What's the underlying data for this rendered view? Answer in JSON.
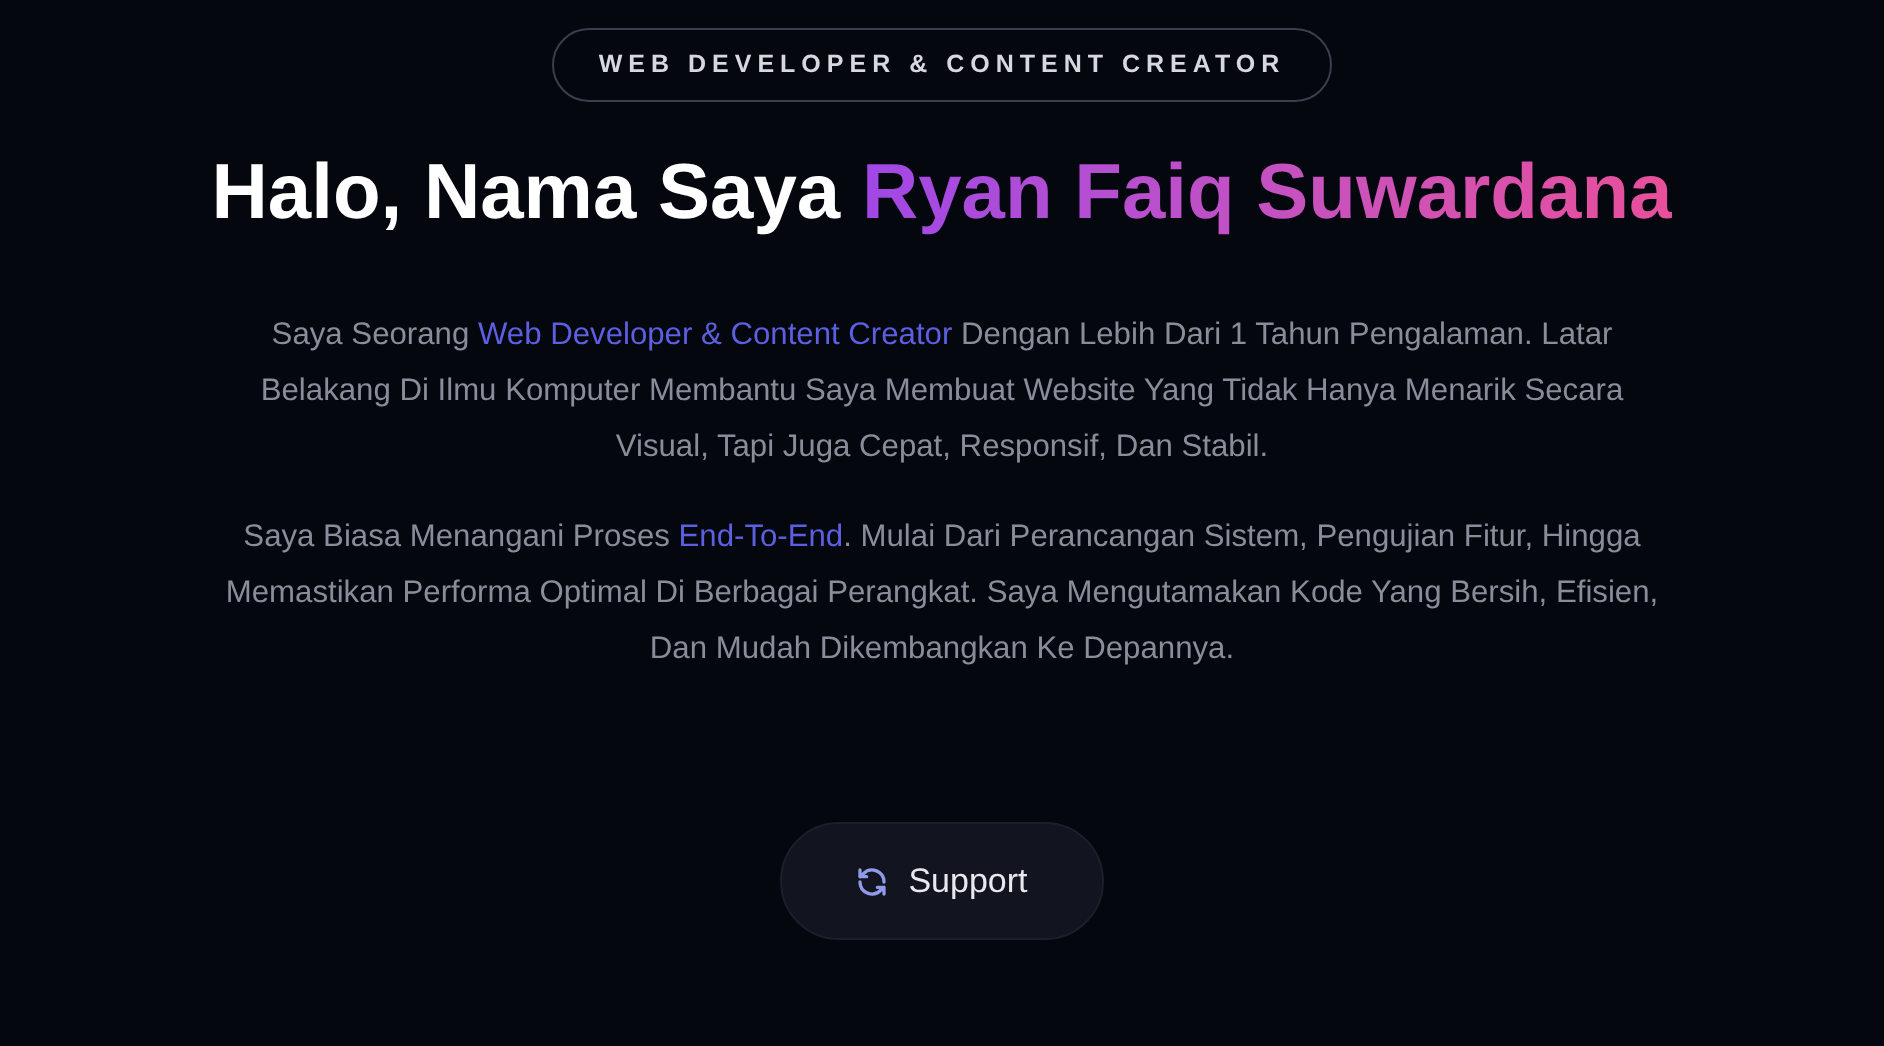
{
  "badge": "WEB DEVELOPER & CONTENT CREATOR",
  "heading": {
    "lead": "Halo, Nama Saya ",
    "name": "Ryan Faiq Suwardana"
  },
  "paragraphs": [
    [
      {
        "text": "Saya Seorang ",
        "highlight": false
      },
      {
        "text": "Web Developer & Content Creator",
        "highlight": true
      },
      {
        "text": " Dengan Lebih Dari 1 Tahun Pengalaman. Latar Belakang Di Ilmu Komputer Membantu Saya Membuat Website Yang Tidak Hanya Menarik Secara Visual, Tapi Juga Cepat, Responsif, Dan Stabil.",
        "highlight": false
      }
    ],
    [
      {
        "text": "Saya Biasa Menangani Proses ",
        "highlight": false
      },
      {
        "text": "End-To-End",
        "highlight": true
      },
      {
        "text": ". Mulai Dari Perancangan Sistem, Pengujian Fitur, Hingga Memastikan Performa Optimal Di Berbagai Perangkat. Saya Mengutamakan Kode Yang Bersih, Efisien, Dan Mudah Dikembangkan Ke Depannya.",
        "highlight": false
      }
    ]
  ],
  "button": {
    "label": "Support"
  }
}
